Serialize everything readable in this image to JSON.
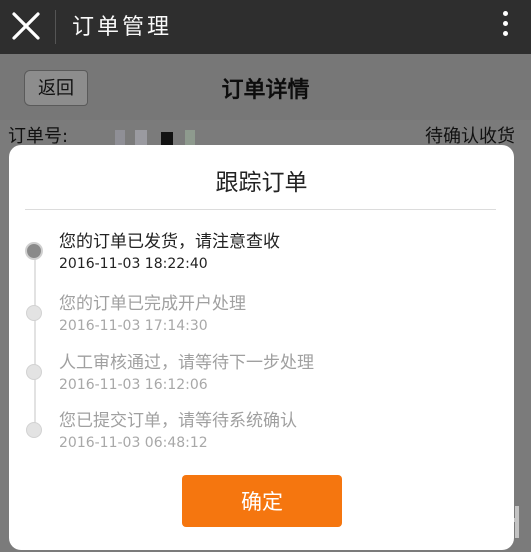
{
  "app_bar": {
    "title": "订单管理"
  },
  "page": {
    "back_label": "返回",
    "title": "订单详情",
    "order_label": "订单号:",
    "order_status": "待确认收货"
  },
  "modal": {
    "title": "跟踪订单",
    "events": [
      {
        "message": "您的订单已发货，请注意查收",
        "time": "2016-11-03 18:22:40"
      },
      {
        "message": "您的订单已完成开户处理",
        "time": "2016-11-03 17:14:30"
      },
      {
        "message": "人工审核通过，请等待下一步处理",
        "time": "2016-11-03 16:12:06"
      },
      {
        "message": "您已提交订单，请等待系统确认",
        "time": "2016-11-03 06:48:12"
      }
    ],
    "confirm_label": "确定"
  },
  "colors": {
    "accent": "#f5760f",
    "appbar": "#2e2e2e"
  }
}
